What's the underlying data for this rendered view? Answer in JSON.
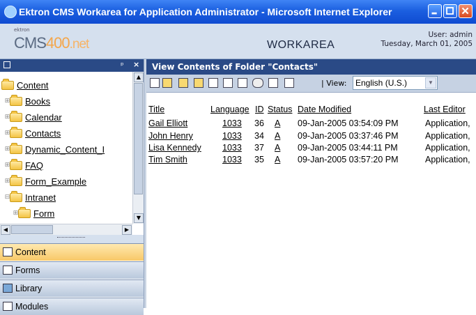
{
  "window": {
    "title": "Ektron CMS Workarea for Application Administrator - Microsoft Internet Explorer"
  },
  "header": {
    "logo_small": "ektron",
    "logo_cms": "CMS",
    "logo_400": "400",
    "logo_net": ".net",
    "workarea": "WORKAREA",
    "user": "User: admin",
    "date": "Tuesday, March 01, 2005"
  },
  "tree": {
    "items": [
      {
        "label": "Content"
      },
      {
        "label": "Books"
      },
      {
        "label": "Calendar"
      },
      {
        "label": "Contacts"
      },
      {
        "label": "Dynamic_Content_I"
      },
      {
        "label": "FAQ"
      },
      {
        "label": "Form_Example"
      },
      {
        "label": "Intranet"
      },
      {
        "label": "Form"
      }
    ]
  },
  "tabs": [
    {
      "label": "Content",
      "active": true
    },
    {
      "label": "Forms"
    },
    {
      "label": "Library"
    },
    {
      "label": "Modules"
    }
  ],
  "main": {
    "title": "View Contents of Folder \"Contacts\"",
    "view_label": "| View:",
    "language": "English (U.S.)",
    "columns": [
      "Title",
      "Language",
      "ID",
      "Status",
      "Date Modified",
      "Last Editor"
    ],
    "rows": [
      {
        "title": "Gail Elliott",
        "language": "1033",
        "id": "36",
        "status": "A",
        "date": "09-Jan-2005 03:54:09 PM",
        "editor": "Application,"
      },
      {
        "title": "John Henry",
        "language": "1033",
        "id": "34",
        "status": "A",
        "date": "09-Jan-2005 03:37:46 PM",
        "editor": "Application,"
      },
      {
        "title": "Lisa Kennedy",
        "language": "1033",
        "id": "37",
        "status": "A",
        "date": "09-Jan-2005 03:44:11 PM",
        "editor": "Application,"
      },
      {
        "title": "Tim Smith",
        "language": "1033",
        "id": "35",
        "status": "A",
        "date": "09-Jan-2005 03:57:20 PM",
        "editor": "Application,"
      }
    ]
  },
  "colors": {
    "titlebar": "#1b5fe0",
    "panel_head": "#2a4a86",
    "header_bg": "#d5e0ee",
    "active_tab": "#f8c867",
    "accent_orange": "#f4a64b"
  },
  "icons": [
    "ie-icon",
    "minimize-icon",
    "maximize-icon",
    "close-icon",
    "folder-icon",
    "pin-icon",
    "binoculars-icon",
    "content-icon",
    "forms-icon",
    "library-icon"
  ]
}
